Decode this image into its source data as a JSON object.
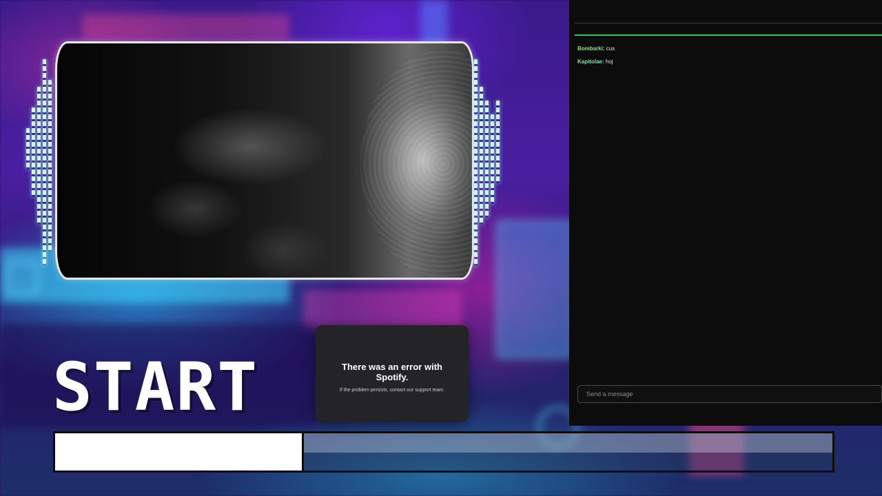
{
  "scene": {
    "start_label": "START"
  },
  "progress": {
    "fraction": 0.32
  },
  "spotify_toast": {
    "title": "There was an error with Spotify.",
    "subtitle": "If the problem persists, contact our support team."
  },
  "chat": {
    "messages": [
      {
        "user": "Bombarki",
        "text": "cus"
      },
      {
        "user": "Kapitolae",
        "text": "hoj"
      }
    ],
    "input_placeholder": "Send a message",
    "accent_color": "#3ec45a"
  }
}
